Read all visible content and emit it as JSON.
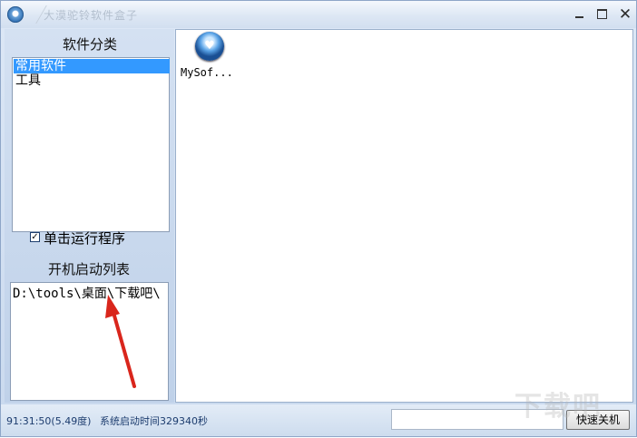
{
  "window": {
    "title": "大漠驼铃软件盒子",
    "minimize_glyph": "–",
    "maximize_glyph": "□",
    "close_glyph": "✕"
  },
  "left_panel": {
    "category_title": "软件分类",
    "categories": [
      {
        "label": "常用软件",
        "selected": true
      },
      {
        "label": "工具",
        "selected": false
      }
    ],
    "single_click_checkbox": {
      "label": "单击运行程序",
      "checked": true,
      "glyph": "✓"
    },
    "startup_title": "开机启动列表",
    "startup_items": [
      "D:\\tools\\桌面\\下载吧\\"
    ]
  },
  "main": {
    "apps": [
      {
        "label": "MySof...",
        "icon": "heart-globe-icon"
      }
    ]
  },
  "statusbar": {
    "time": "91:31:50(5.49度)",
    "uptime": "系统启动时间329340秒",
    "input_value": "",
    "shutdown_label": "快速关机"
  },
  "annotation": {
    "arrow_color": "#d9261c"
  },
  "watermark": {
    "text": "下载吧"
  }
}
